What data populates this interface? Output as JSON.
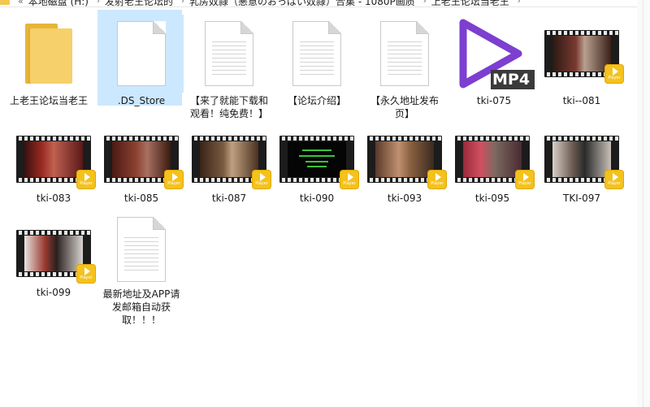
{
  "address_bar": {
    "crumbs": [
      "本地磁盘 (H:)",
      "发射老王论坛的",
      "乳房奴隷（悪意のおっぱい奴隷）合集 - 1080P画质",
      "上老王论坛当老王"
    ]
  },
  "items": [
    {
      "name": "上老王论坛当老王",
      "kind": "folder"
    },
    {
      "name": ".DS_Store",
      "kind": "blank-file"
    },
    {
      "name": "【来了就能下载和观看！纯免费！】",
      "kind": "document"
    },
    {
      "name": "【论坛介绍】",
      "kind": "document"
    },
    {
      "name": "【永久地址发布页】",
      "kind": "document"
    },
    {
      "name": "tki-075",
      "kind": "mp4"
    },
    {
      "name": "tki--081",
      "kind": "video"
    },
    {
      "name": "tki-083",
      "kind": "video"
    },
    {
      "name": "tki-085",
      "kind": "video"
    },
    {
      "name": "tki-087",
      "kind": "video"
    },
    {
      "name": "tki-090",
      "kind": "video"
    },
    {
      "name": "tki-093",
      "kind": "video"
    },
    {
      "name": "tki-095",
      "kind": "video"
    },
    {
      "name": "TKI-097",
      "kind": "video"
    },
    {
      "name": "tki-099",
      "kind": "video"
    },
    {
      "name": "最新地址及APP请发邮箱自动获取！！！",
      "kind": "document"
    }
  ],
  "player_badge": {
    "text": "Player"
  },
  "mp4_label": "MP4",
  "colors": {
    "selection": "#cce8ff",
    "folder": "#f6d06a",
    "badge": "#f4c21d",
    "mp4_purple": "#7c3fd0"
  }
}
